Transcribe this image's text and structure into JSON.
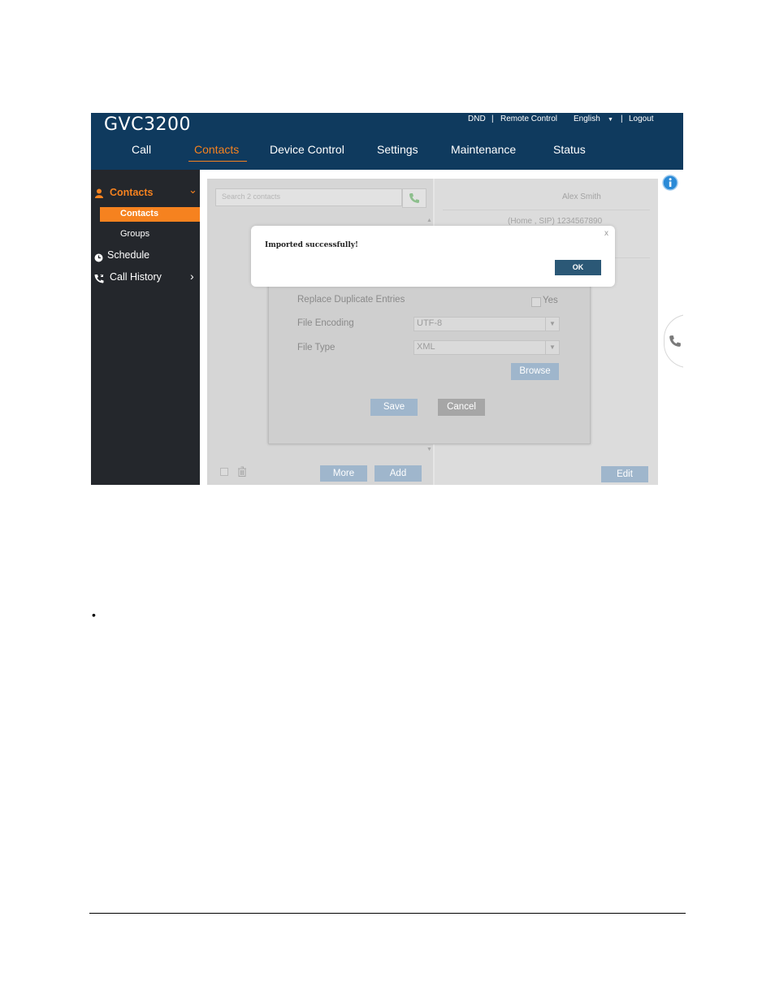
{
  "header": {
    "brand": "GVC3200",
    "top_links": {
      "dnd": "DND",
      "sep1": "|",
      "remote_control": "Remote Control",
      "language": "English",
      "language_arrow": "▼",
      "sep2": "|",
      "logout": "Logout"
    },
    "nav": {
      "call": "Call",
      "contacts": "Contacts",
      "device_control": "Device Control",
      "settings": "Settings",
      "maintenance": "Maintenance",
      "status": "Status"
    },
    "accent_color": "#f6821f",
    "background_color": "#0f3a5e"
  },
  "sidebar": {
    "contacts_header": "Contacts",
    "contacts_chevron": "⌄",
    "contacts_sub": "Contacts",
    "groups": "Groups",
    "schedule": "Schedule",
    "call_history": "Call History",
    "call_history_chevron": "›"
  },
  "contacts_list": {
    "search_placeholder": "Search 2 contacts",
    "more_button": "More",
    "add_button": "Add"
  },
  "contact_detail": {
    "name": "Alex Smith",
    "number": "(Home , SIP) 1234567890",
    "edit_button": "Edit"
  },
  "import_panel": {
    "replace_duplicates_label": "Replace Duplicate Entries",
    "replace_duplicates_option": "Yes",
    "file_encoding_label": "File Encoding",
    "file_encoding_value": "UTF-8",
    "file_type_label": "File Type",
    "file_type_value": "XML",
    "browse_button": "Browse",
    "save_button": "Save",
    "cancel_button": "Cancel"
  },
  "modal": {
    "message": "Imported successfully!",
    "close": "x",
    "ok_button": "OK"
  },
  "document": {
    "bullet": "•"
  }
}
